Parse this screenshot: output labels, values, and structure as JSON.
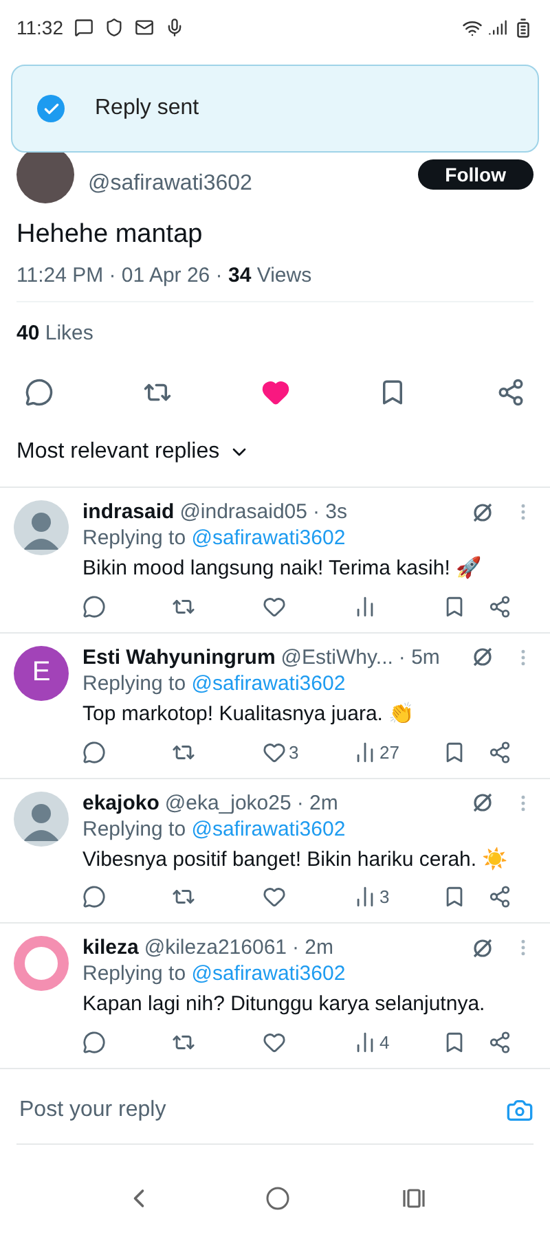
{
  "status_bar": {
    "time": "11:32"
  },
  "toast": {
    "message": "Reply sent"
  },
  "post": {
    "handle": "@safirawati3602",
    "follow_label": "Follow",
    "text": "Hehehe mantap",
    "time": "11:24 PM · 01 Apr 26 · ",
    "views_count": "34",
    "views_label": " Views",
    "likes_count": "40",
    "likes_label": " Likes",
    "liked": true,
    "bookmarked": false
  },
  "sort": {
    "label": "Most relevant replies"
  },
  "replies": [
    {
      "avatar": {
        "kind": "default"
      },
      "name": "indrasaid",
      "handle": "@indrasaid05",
      "time": "· 3s",
      "replying_label": "Replying to ",
      "mention": "@safirawati3602",
      "text": "Bikin mood langsung naik! Terima kasih! 🚀"
    },
    {
      "avatar": {
        "kind": "letter",
        "letter": "E",
        "color": "#a243b8"
      },
      "name": "Esti Wahyuningrum",
      "handle": "@EstiWhy...",
      "time": "· 5m",
      "replying_label": "Replying to ",
      "mention": "@safirawati3602",
      "text": "Top markotop! Kualitasnya juara. 👏",
      "likes": "3",
      "views": "27"
    },
    {
      "avatar": {
        "kind": "default"
      },
      "name": "ekajoko",
      "handle": "@eka_joko25",
      "time": "· 2m",
      "replying_label": "Replying to ",
      "mention": "@safirawati3602",
      "text": "Vibesnya positif banget! Bikin hariku cerah. ☀️",
      "views": "3"
    },
    {
      "avatar": {
        "kind": "ring",
        "color": "#f48fb1"
      },
      "name": "kileza",
      "handle": "@kileza216061",
      "time": "· 2m",
      "replying_label": "Replying to ",
      "mention": "@safirawati3602",
      "text": "Kapan lagi nih? Ditunggu karya selanjutnya.",
      "views": "4"
    }
  ],
  "composer": {
    "placeholder": "Post your reply"
  }
}
